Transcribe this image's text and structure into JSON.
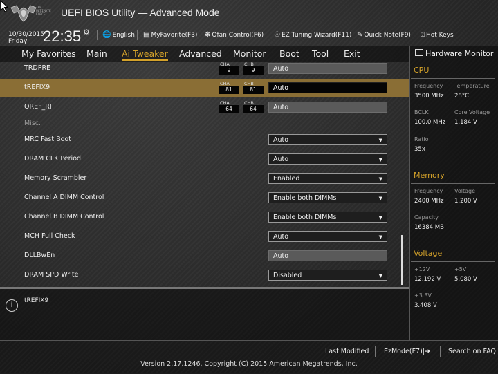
{
  "header": {
    "logo_text": "THE ULTIMATE FORCE",
    "title": "UEFI BIOS Utility — Advanced Mode"
  },
  "datetime": {
    "date": "10/30/2015",
    "day": "Friday",
    "time": "22:35"
  },
  "toolbar": {
    "language": "English",
    "favorite": "MyFavorite(F3)",
    "qfan": "Qfan Control(F6)",
    "ez_tuning": "EZ Tuning Wizard(F11)",
    "quick_note": "Quick Note(F9)",
    "hot_keys": "Hot Keys"
  },
  "menu": [
    "My Favorites",
    "Main",
    "Ai Tweaker",
    "Advanced",
    "Monitor",
    "Boot",
    "Tool",
    "Exit"
  ],
  "menu_active": "Ai Tweaker",
  "rows": {
    "trdpre": {
      "label": "TRDPRE",
      "cha_label": "CHA",
      "cha": "9",
      "chb_label": "CHB",
      "chb": "9",
      "value": "Auto"
    },
    "trefix9": {
      "label": "tREFIX9",
      "cha_label": "CHA",
      "cha": "81",
      "chb_label": "CHB",
      "chb": "81",
      "value": "Auto"
    },
    "oref": {
      "label": "OREF_RI",
      "cha_label": "CHA",
      "cha": "64",
      "chb_label": "CHB",
      "chb": "64",
      "value": "Auto"
    },
    "misc": {
      "label": "Misc."
    },
    "mrc": {
      "label": "MRC Fast Boot",
      "value": "Auto"
    },
    "dram_clk": {
      "label": "DRAM CLK Period",
      "value": "Auto"
    },
    "scrambler": {
      "label": "Memory Scrambler",
      "value": "Enabled"
    },
    "ch_a": {
      "label": "Channel A DIMM Control",
      "value": "Enable both DIMMs"
    },
    "ch_b": {
      "label": "Channel B DIMM Control",
      "value": "Enable both DIMMs"
    },
    "mch": {
      "label": "MCH Full Check",
      "value": "Auto"
    },
    "dllbwen": {
      "label": "DLLBwEn",
      "value": "Auto"
    },
    "spd": {
      "label": "DRAM SPD Write",
      "value": "Disabled"
    }
  },
  "help": {
    "text": "tREFIX9"
  },
  "hw": {
    "title": "Hardware Monitor",
    "cpu": {
      "heading": "CPU",
      "freq_label": "Frequency",
      "freq": "3500 MHz",
      "temp_label": "Temperature",
      "temp": "28°C",
      "bclk_label": "BCLK",
      "bclk": "100.0 MHz",
      "vcore_label": "Core Voltage",
      "vcore": "1.184 V",
      "ratio_label": "Ratio",
      "ratio": "35x"
    },
    "memory": {
      "heading": "Memory",
      "freq_label": "Frequency",
      "freq": "2400 MHz",
      "volt_label": "Voltage",
      "volt": "1.200 V",
      "cap_label": "Capacity",
      "cap": "16384 MB"
    },
    "voltage": {
      "heading": "Voltage",
      "v12_label": "+12V",
      "v12": "12.192 V",
      "v5_label": "+5V",
      "v5": "5.080 V",
      "v33_label": "+3.3V",
      "v33": "3.408 V"
    }
  },
  "footer": {
    "last_modified": "Last Modified",
    "ezmode": "EzMode(F7)",
    "search": "Search on FAQ",
    "copyright": "Version 2.17.1246. Copyright (C) 2015 American Megatrends, Inc."
  },
  "colors": {
    "accent": "#d4a22a",
    "highlight": "#8a6e35"
  }
}
